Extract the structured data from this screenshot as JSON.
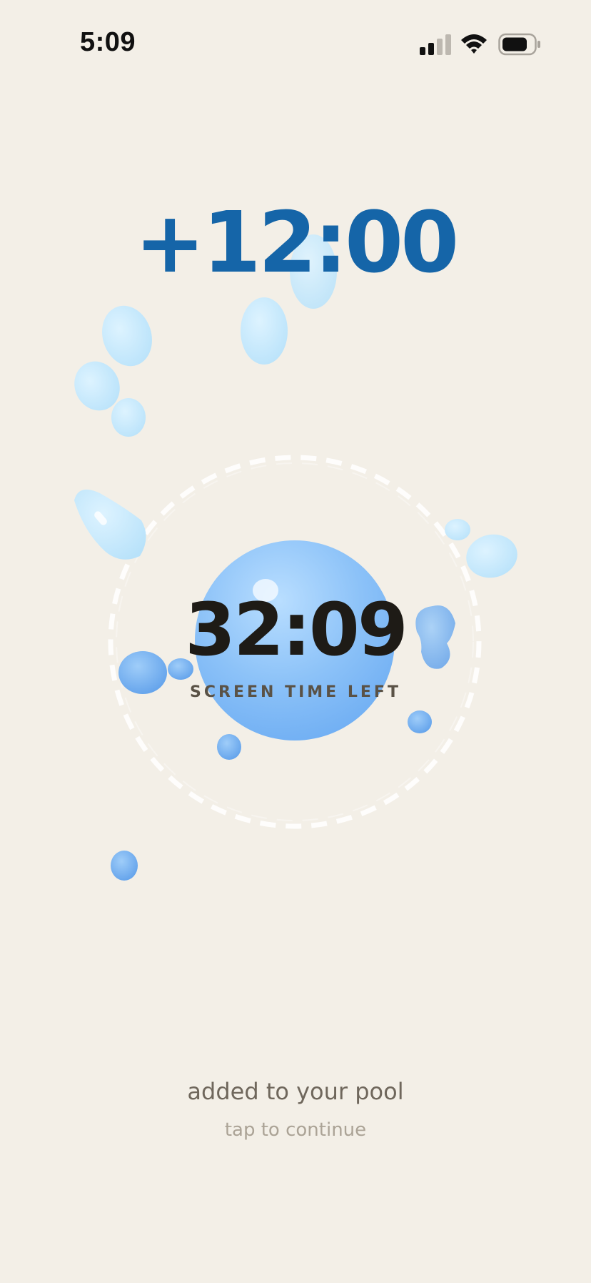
{
  "status_bar": {
    "time": "5:09",
    "icons": [
      "cellular-signal-icon",
      "wifi-icon",
      "battery-icon"
    ]
  },
  "reward": {
    "bonus_time": "+12:00"
  },
  "pool": {
    "time_left": "32:09",
    "time_left_label": "SCREEN TIME LEFT"
  },
  "message": {
    "headline": "added to your pool",
    "hint": "tap to continue"
  },
  "colors": {
    "background": "#F3EFE7",
    "bonus_text": "#1565A8",
    "bubble_blue": "#7DB7F5",
    "light_drop": "#C8EAFB"
  }
}
